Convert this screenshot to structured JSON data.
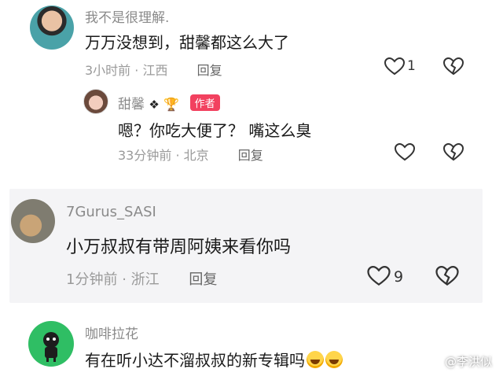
{
  "comments": [
    {
      "username": "我不是很理解.",
      "text": "万万没想到，甜馨都这么大了",
      "time": "3小时前",
      "location": "江西",
      "reply_label": "回复",
      "likes": "1",
      "replies": [
        {
          "username": "甜馨",
          "badge": "作者",
          "text": "嗯？你吃大便了？ 嘴这么臭",
          "time": "33分钟前",
          "location": "北京",
          "reply_label": "回复"
        }
      ]
    },
    {
      "username": "7Gurus_SASI",
      "text": "小万叔叔有带周阿姨来看你吗",
      "time": "1分钟前",
      "location": "浙江",
      "reply_label": "回复",
      "likes": "9"
    },
    {
      "username": "咖啡拉花",
      "text": "有在听小达不溜叔叔的新专辑吗"
    }
  ],
  "watermark": "@李洪似",
  "icons": {
    "like": "heart-outline-icon",
    "dislike": "broken-heart-icon",
    "paw": "paw-icon",
    "trophy": "trophy-icon",
    "emoji": "laugh-cry-emoji-icon"
  }
}
